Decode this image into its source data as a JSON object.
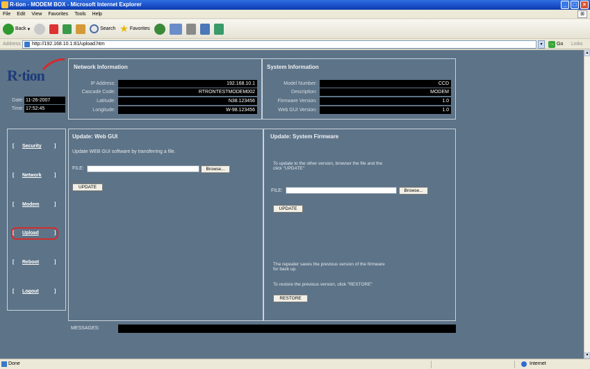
{
  "window": {
    "title": "R-tion - MODEM BOX - Microsoft Internet Explorer"
  },
  "menu": [
    "File",
    "Edit",
    "View",
    "Favorites",
    "Tools",
    "Help"
  ],
  "toolbar": {
    "back": "Back",
    "search": "Search",
    "favorites": "Favorites"
  },
  "address": {
    "label": "Address",
    "url": "http://192.168.10.1:81/upload.htm",
    "go": "Go",
    "links": "Links"
  },
  "logo": "R·tion",
  "datetime": {
    "date_label": "Date:",
    "date": "11-26-2007",
    "time_label": "Time:",
    "time": "17:52:45"
  },
  "network": {
    "title": "Network Information",
    "rows": [
      {
        "label": "IP Address:",
        "value": "192.168.10.1"
      },
      {
        "label": "Cascade Code:",
        "value": "RTRONTESTMODEM002"
      },
      {
        "label": "Latitude:",
        "value": "N38.123456"
      },
      {
        "label": "Longitude:",
        "value": "W-98.123456"
      }
    ]
  },
  "system": {
    "title": "System Information",
    "rows": [
      {
        "label": "Model Number:",
        "value": "CCD"
      },
      {
        "label": "Description:",
        "value": "MODEM"
      },
      {
        "label": "Firmware Version:",
        "value": "1.0"
      },
      {
        "label": "Web GUI Version:",
        "value": "1.0"
      }
    ]
  },
  "nav": [
    "Security",
    "Network",
    "Modem",
    "Upload",
    "Reboot",
    "Logout"
  ],
  "webgui": {
    "title": "Update:  Web GUI",
    "desc": "Update WEB GUI software by transferring a file.",
    "file_label": "FILE:",
    "browse": "Browse...",
    "update": "UPDATE"
  },
  "firmware": {
    "title": "Update:  System Firmware",
    "desc1": "To update to the other version, browser the file and the",
    "desc2": "click \"UPDATE\"",
    "file_label": "FILE:",
    "browse": "Browse...",
    "update": "UPDATE",
    "note1": "The repeater saves the previous version of the firmware",
    "note2": "for back up.",
    "restore_text": "To restore the previous version, click \"RESTORE\"",
    "restore": "RESTORE"
  },
  "messages": {
    "label": "MESSAGES:"
  },
  "status": {
    "text": "Done",
    "zone": "Internet"
  }
}
